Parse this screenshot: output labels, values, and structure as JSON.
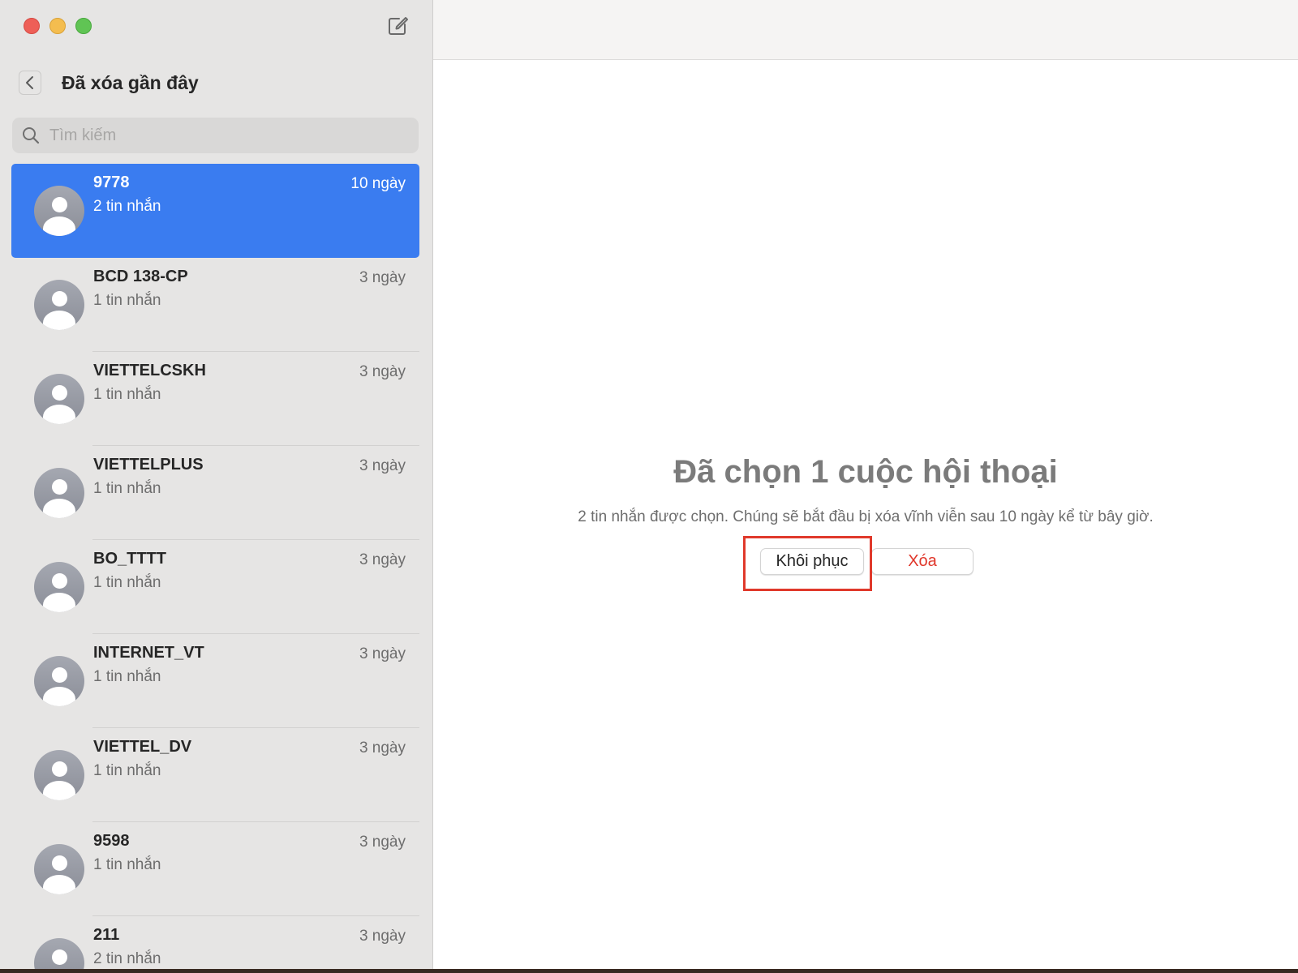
{
  "sidebar": {
    "title": "Đã xóa gần đây",
    "search_placeholder": "Tìm kiếm",
    "items": [
      {
        "name": "9778",
        "sub": "2 tin nhắn",
        "date": "10 ngày",
        "selected": true
      },
      {
        "name": "BCD 138-CP",
        "sub": "1 tin nhắn",
        "date": "3 ngày"
      },
      {
        "name": "VIETTELCSKH",
        "sub": "1 tin nhắn",
        "date": "3 ngày"
      },
      {
        "name": "VIETTELPLUS",
        "sub": "1 tin nhắn",
        "date": "3 ngày"
      },
      {
        "name": "BO_TTTT",
        "sub": "1 tin nhắn",
        "date": "3 ngày"
      },
      {
        "name": "INTERNET_VT",
        "sub": "1 tin nhắn",
        "date": "3 ngày"
      },
      {
        "name": "VIETTEL_DV",
        "sub": "1 tin nhắn",
        "date": "3 ngày"
      },
      {
        "name": "9598",
        "sub": "1 tin nhắn",
        "date": "3 ngày"
      },
      {
        "name": "211",
        "sub": "2 tin nhắn",
        "date": "3 ngày"
      }
    ]
  },
  "main": {
    "headline": "Đã chọn 1 cuộc hội thoại",
    "description": "2 tin nhắn được chọn. Chúng sẽ bắt đầu bị xóa vĩnh viễn sau 10 ngày kể từ bây giờ.",
    "restore_label": "Khôi phục",
    "delete_label": "Xóa"
  },
  "colors": {
    "selection": "#3a7cf0",
    "delete": "#e0372b",
    "highlight": "#e0392b"
  },
  "icons": [
    "close-window-icon",
    "minimize-window-icon",
    "zoom-window-icon",
    "compose-icon",
    "chevron-left-icon",
    "search-icon",
    "contact-avatar-icon"
  ]
}
